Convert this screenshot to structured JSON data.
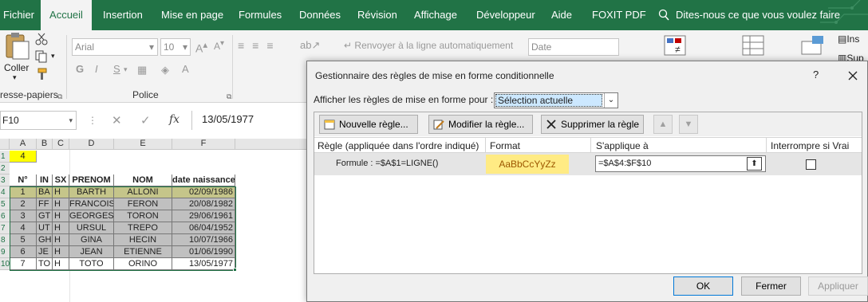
{
  "ribbon_tabs": [
    "Fichier",
    "Accueil",
    "Insertion",
    "Mise en page",
    "Formules",
    "Données",
    "Révision",
    "Affichage",
    "Développeur",
    "Aide",
    "FOXIT PDF"
  ],
  "tell_me": "Dites-nous ce que vous voulez faire",
  "ribbon": {
    "paste_label": "Coller",
    "clipboard_group": "resse-papiers",
    "font_name": "Arial",
    "font_size": "10",
    "font_group": "Police",
    "wrap_text": "Renvoyer à la ligne automatiquement",
    "number_format": "Date",
    "insert_label": "Ins",
    "delete_label": "Sup",
    "bold": "G",
    "italic": "I",
    "underline": "S"
  },
  "formula_bar": {
    "name_box": "F10",
    "fx": "fx",
    "value": "13/05/1977"
  },
  "sheet": {
    "columns": [
      "A",
      "B",
      "C",
      "D",
      "E",
      "F"
    ],
    "rows": [
      "1",
      "2",
      "3",
      "4",
      "5",
      "6",
      "7",
      "8",
      "9",
      "10"
    ],
    "a1": "4",
    "headers": [
      "N°",
      "IN",
      "SX",
      "PRENOM",
      "NOM",
      "date naissance"
    ],
    "records": [
      [
        "1",
        "BA",
        "H",
        "BARTH",
        "ALLONI",
        "02/09/1986"
      ],
      [
        "2",
        "FF",
        "H",
        "FRANCOIS",
        "FERON",
        "20/08/1982"
      ],
      [
        "3",
        "GT",
        "H",
        "GEORGES",
        "TORON",
        "29/06/1961"
      ],
      [
        "4",
        "UT",
        "H",
        "URSUL",
        "TREPO",
        "06/04/1952"
      ],
      [
        "5",
        "GH",
        "H",
        "GINA",
        "HECIN",
        "10/07/1966"
      ],
      [
        "6",
        "JE",
        "H",
        "JEAN",
        "ETIENNE",
        "01/06/1990"
      ],
      [
        "7",
        "TO",
        "H",
        "TOTO",
        "ORINO",
        "13/05/1977"
      ]
    ]
  },
  "dialog": {
    "title": "Gestionnaire des règles de mise en forme conditionnelle",
    "help": "?",
    "show_rules_label": "Afficher les règles de mise en forme pour :",
    "show_rules_value": "Sélection actuelle",
    "new_rule": "Nouvelle règle...",
    "edit_rule": "Modifier la règle...",
    "delete_rule": "Supprimer la règle",
    "columns": {
      "rule": "Règle (appliquée dans l'ordre indiqué)",
      "format": "Format",
      "applies": "S'applique à",
      "stop": "Interrompre si Vrai"
    },
    "rule": {
      "formula": "Formule : =$A$1=LIGNE()",
      "preview": "AaBbCcYyZz",
      "applies_to": "=$A$4:$F$10"
    },
    "ok": "OK",
    "close": "Fermer",
    "apply": "Appliquer"
  },
  "colors": {
    "ribbon_green": "#217346",
    "highlight_row": "#c5c58a",
    "grey_rows": "#c0c0c0",
    "yellow": "#ffff00",
    "preview_bg": "#ffeb84",
    "selection_blue": "#cce8ff"
  }
}
